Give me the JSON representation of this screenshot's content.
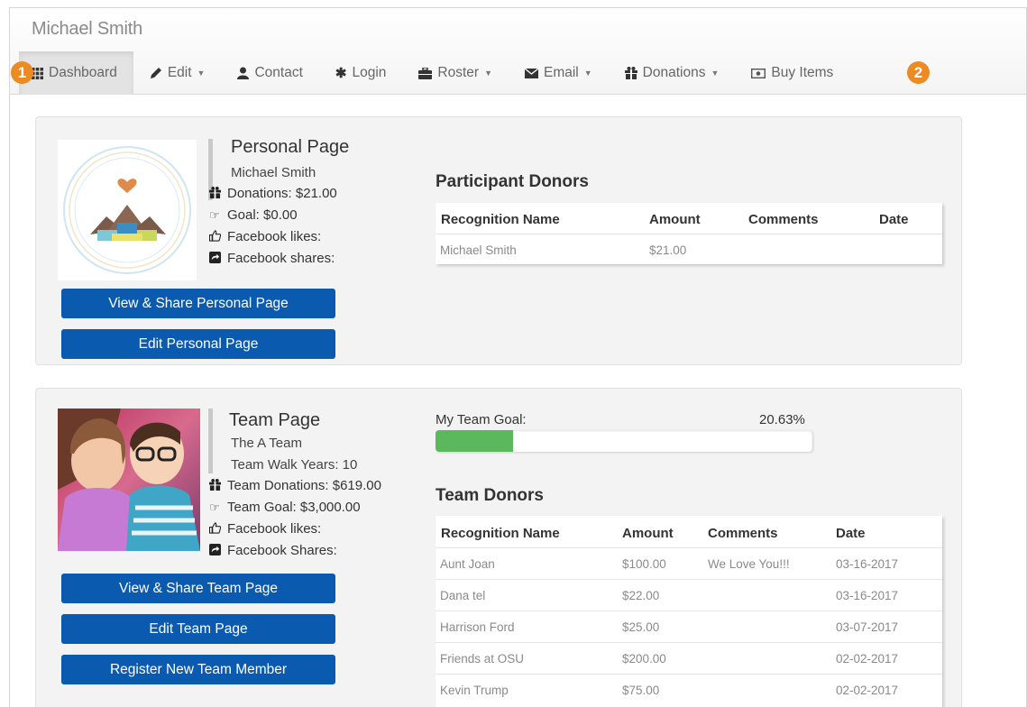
{
  "header": {
    "user_name": "Michael Smith"
  },
  "nav": [
    {
      "label": "Dashboard",
      "icon": "grid-icon",
      "caret": false,
      "active": true
    },
    {
      "label": "Edit",
      "icon": "pencil-icon",
      "caret": true
    },
    {
      "label": "Contact",
      "icon": "user-icon",
      "caret": false
    },
    {
      "label": "Login",
      "icon": "asterisk-icon",
      "caret": false
    },
    {
      "label": "Roster",
      "icon": "briefcase-icon",
      "caret": true
    },
    {
      "label": "Email",
      "icon": "envelope-icon",
      "caret": true
    },
    {
      "label": "Donations",
      "icon": "gift-icon",
      "caret": true
    },
    {
      "label": "Buy Items",
      "icon": "money-icon",
      "caret": false
    }
  ],
  "callouts": {
    "one": "1",
    "two": "2"
  },
  "personal": {
    "title": "Personal Page",
    "name": "Michael Smith",
    "donations": "Donations: $21.00",
    "goal": "Goal: $0.00",
    "fb_likes": "Facebook likes:",
    "fb_shares": "Facebook shares:",
    "view_button": "View & Share Personal Page",
    "edit_button": "Edit Personal Page",
    "donors_title": "Participant Donors",
    "columns": [
      "Recognition Name",
      "Amount",
      "Comments",
      "Date"
    ],
    "rows": [
      {
        "name": "Michael Smith",
        "amount": "$21.00",
        "comment": "",
        "date": ""
      }
    ]
  },
  "team": {
    "title": "Team Page",
    "team_name": "The A Team",
    "walk_years": "Team Walk Years: 10",
    "donations": "Team Donations: $619.00",
    "goal": "Team Goal: $3,000.00",
    "fb_likes": "Facebook likes:",
    "fb_shares": "Facebook Shares:",
    "view_button": "View & Share Team Page",
    "edit_button": "Edit Team Page",
    "register_button": "Register New Team Member",
    "goal_label": "My Team Goal:",
    "goal_percent": "20.63%",
    "goal_fraction": 0.2063,
    "donors_title": "Team Donors",
    "columns": [
      "Recognition Name",
      "Amount",
      "Comments",
      "Date"
    ],
    "rows": [
      {
        "name": "Aunt Joan",
        "amount": "$100.00",
        "comment": "We Love You!!!",
        "date": "03-16-2017"
      },
      {
        "name": "Dana tel",
        "amount": "$22.00",
        "comment": "",
        "date": "03-16-2017"
      },
      {
        "name": "Harrison Ford",
        "amount": "$25.00",
        "comment": "",
        "date": "03-07-2017"
      },
      {
        "name": "Friends at OSU",
        "amount": "$200.00",
        "comment": "",
        "date": "02-02-2017"
      },
      {
        "name": "Kevin Trump",
        "amount": "$75.00",
        "comment": "",
        "date": "02-02-2017"
      }
    ]
  },
  "colors": {
    "primary_button": "#0a5ab0",
    "progress": "#5cb85c",
    "callout": "#ec8a23"
  }
}
